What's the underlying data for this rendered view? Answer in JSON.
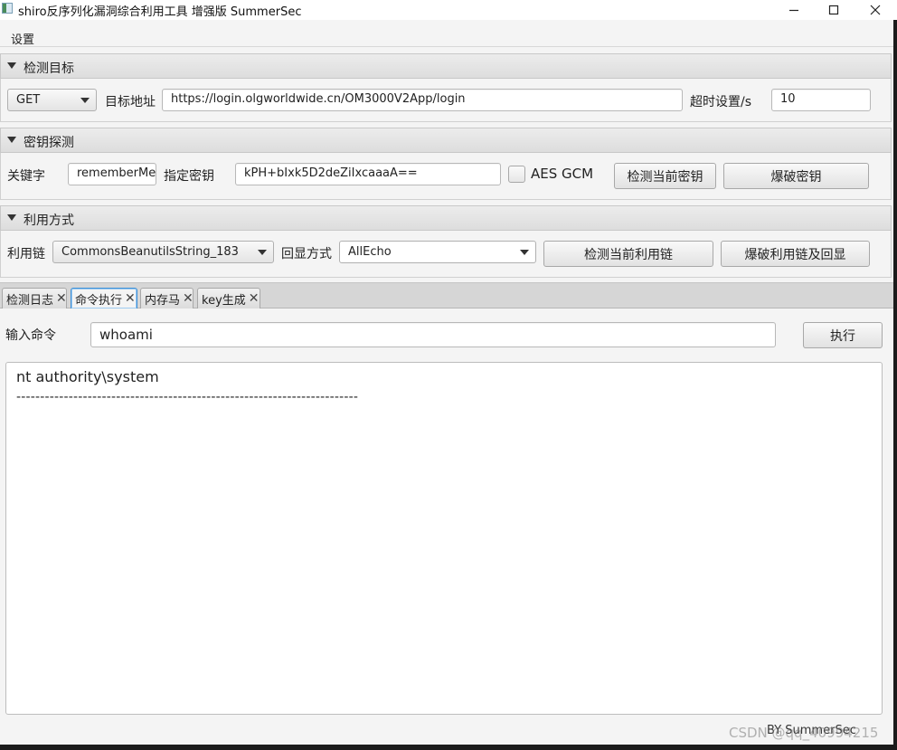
{
  "window": {
    "title": "shiro反序列化漏洞综合利用工具 增强版 SummerSec",
    "minimize": "minimize-icon",
    "maximize": "maximize-icon",
    "close": "close-icon"
  },
  "menu": {
    "settings": "设置"
  },
  "target_pane": {
    "title": "检测目标",
    "method": "GET",
    "url_label": "目标地址",
    "url": "https://login.olgworldwide.cn/OM3000V2App/login",
    "timeout_label": "超时设置/s",
    "timeout": "10"
  },
  "key_pane": {
    "title": "密钥探测",
    "keyword_label": "关键字",
    "keyword": "rememberMe",
    "key_label": "指定密钥",
    "key": "kPH+bIxk5D2deZiIxcaaaA==",
    "aes_gcm_label": "AES GCM",
    "aes_gcm_checked": false,
    "check_key_button": "检测当前密钥",
    "brute_key_button": "爆破密钥"
  },
  "exploit_pane": {
    "title": "利用方式",
    "chain_label": "利用链",
    "chain": "CommonsBeanutilsString_183",
    "echo_label": "回显方式",
    "echo": "AllEcho",
    "check_chain_button": "检测当前利用链",
    "brute_chain_button": "爆破利用链及回显"
  },
  "tabs": [
    {
      "label": "检测日志",
      "active": false
    },
    {
      "label": "命令执行",
      "active": true
    },
    {
      "label": "内存马",
      "active": false
    },
    {
      "label": "key生成",
      "active": false
    }
  ],
  "command": {
    "input_label": "输入命令",
    "input": "whoami",
    "execute_button": "执行",
    "output_line": "nt authority\\system",
    "output_separator": "------------------------------------------------------------------------"
  },
  "footer": {
    "credit": "BY   SummerSec",
    "watermark": "CSDN @qq_40994215"
  }
}
